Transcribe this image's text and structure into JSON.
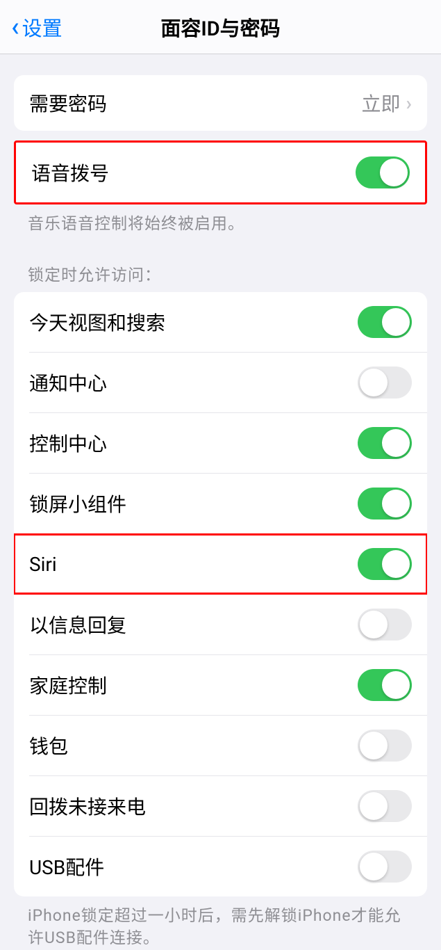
{
  "header": {
    "back_label": "设置",
    "title": "面容ID与密码"
  },
  "passcode": {
    "label": "需要密码",
    "value": "立即"
  },
  "voice_dial": {
    "label": "语音拨号",
    "on": true,
    "footer": "音乐语音控制将始终被启用。"
  },
  "lock_access": {
    "header": "锁定时允许访问：",
    "items": [
      {
        "label": "今天视图和搜索",
        "on": true
      },
      {
        "label": "通知中心",
        "on": false
      },
      {
        "label": "控制中心",
        "on": true
      },
      {
        "label": "锁屏小组件",
        "on": true
      },
      {
        "label": "Siri",
        "on": true
      },
      {
        "label": "以信息回复",
        "on": false
      },
      {
        "label": "家庭控制",
        "on": true
      },
      {
        "label": "钱包",
        "on": false
      },
      {
        "label": "回拨未接来电",
        "on": false
      },
      {
        "label": "USB配件",
        "on": false
      }
    ],
    "footer": "iPhone锁定超过一小时后，需先解锁iPhone才能允许USB配件连接。"
  }
}
